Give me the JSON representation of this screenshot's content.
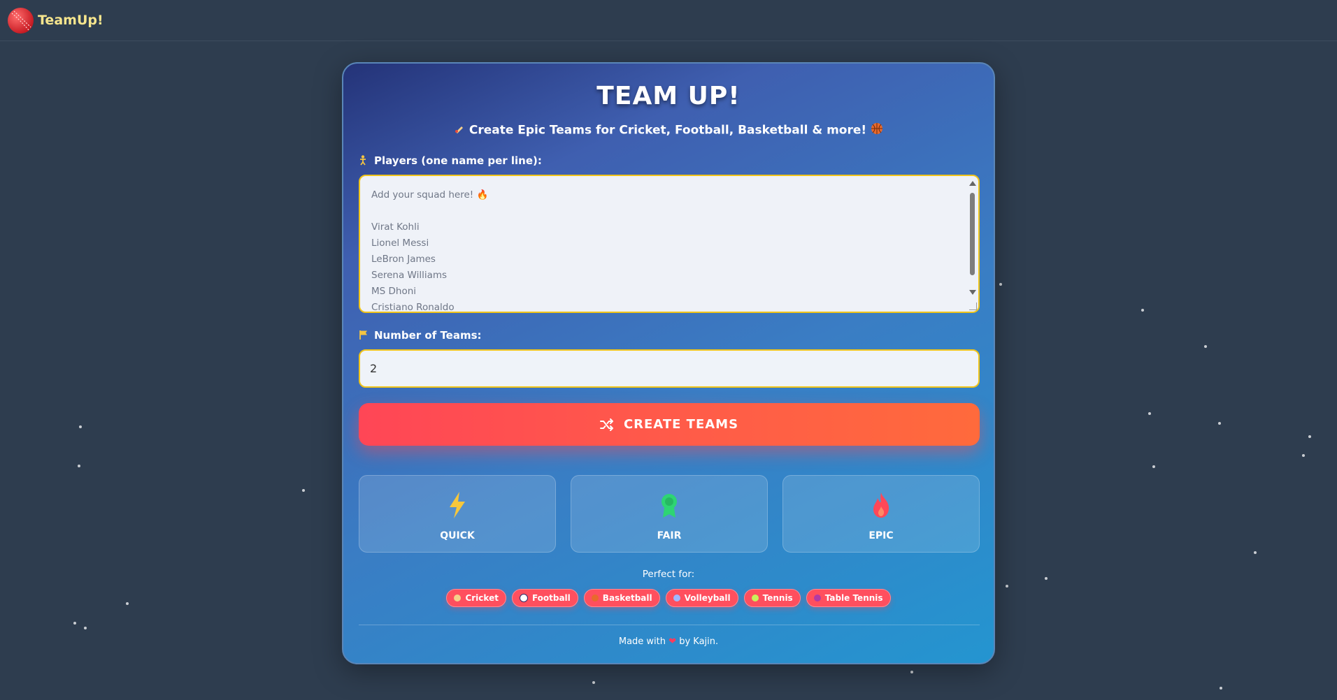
{
  "navbar": {
    "brand": "TeamUp!"
  },
  "main": {
    "title": "TEAM UP!",
    "subtitle_text": "Create Epic Teams for Cricket, Football, Basketball & more!",
    "players_label": "Players (one name per line):",
    "players_placeholder": "Add your squad here! 🔥\n\nVirat Kohli\nLionel Messi\nLeBron James\nSerena Williams\nMS Dhoni\nCristiano Ronaldo",
    "teams_label": "Number of Teams:",
    "teams_value": "2",
    "create_button": "CREATE TEAMS",
    "features": [
      {
        "label": "QUICK",
        "icon": "lightning-icon"
      },
      {
        "label": "FAIR",
        "icon": "award-icon"
      },
      {
        "label": "EPIC",
        "icon": "fire-icon"
      }
    ],
    "perfect_for": "Perfect for:",
    "sports": [
      {
        "label": "Cricket",
        "icon": "cricket-icon"
      },
      {
        "label": "Football",
        "icon": "football-icon"
      },
      {
        "label": "Basketball",
        "icon": "basketball-icon"
      },
      {
        "label": "Volleyball",
        "icon": "volleyball-icon"
      },
      {
        "label": "Tennis",
        "icon": "tennis-icon"
      },
      {
        "label": "Table Tennis",
        "icon": "table-tennis-icon"
      }
    ],
    "footer_before": "Made with",
    "footer_heart": "❤",
    "footer_after": "by Kajin."
  },
  "colors": {
    "background": "#2e3d4f",
    "brand": "#f6e58d",
    "accent": "#ff4f5e",
    "input_border": "#f0c419"
  }
}
